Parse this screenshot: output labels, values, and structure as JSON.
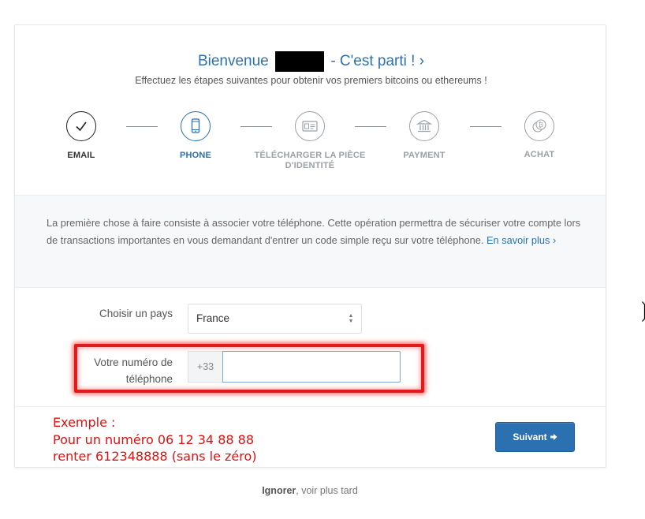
{
  "header": {
    "title_prefix": "Bienvenue",
    "title_suffix": "- C'est parti ! ›",
    "subtitle": "Effectuez les étapes suivantes pour obtenir vos premiers bitcoins ou ethereums !"
  },
  "steps": [
    {
      "label": "EMAIL",
      "state": "done",
      "icon": "check-icon"
    },
    {
      "label": "PHONE",
      "state": "active",
      "icon": "phone-icon"
    },
    {
      "label_line1": "TÉLÉCHARGER LA PIÈCE",
      "label_line2": "D'IDENTITÉ",
      "state": "pending",
      "icon": "id-card-icon"
    },
    {
      "label": "PAYMENT",
      "state": "pending",
      "icon": "bank-icon"
    },
    {
      "label": "ACHAT",
      "state": "pending",
      "icon": "bitcoin-coin-icon"
    }
  ],
  "info": {
    "text": "La première chose à faire consiste à associer votre téléphone. Cette opération permettra de sécuriser votre compte lors de transactions importantes en vous demandant d'entrer un code simple reçu sur votre téléphone.",
    "link": "En savoir plus ›"
  },
  "form": {
    "country_label": "Choisir un pays",
    "country_value": "France",
    "phone_label_line1": "Votre numéro de",
    "phone_label_line2": "téléphone",
    "phone_prefix": "+33",
    "phone_value": "",
    "phone_placeholder": ""
  },
  "annotation": {
    "line1": "Exemple :",
    "line2": "Pour un numéro 06 12 34 88 88",
    "line3": "renter 612348888 (sans le zéro)"
  },
  "actions": {
    "submit_label": "Suivant",
    "skip_bold": "Ignorer",
    "skip_rest": ", voir plus tard"
  },
  "colors": {
    "accent": "#2b71b1",
    "annotation_red": "#e0100e",
    "highlight_red": "#e11b1b"
  }
}
